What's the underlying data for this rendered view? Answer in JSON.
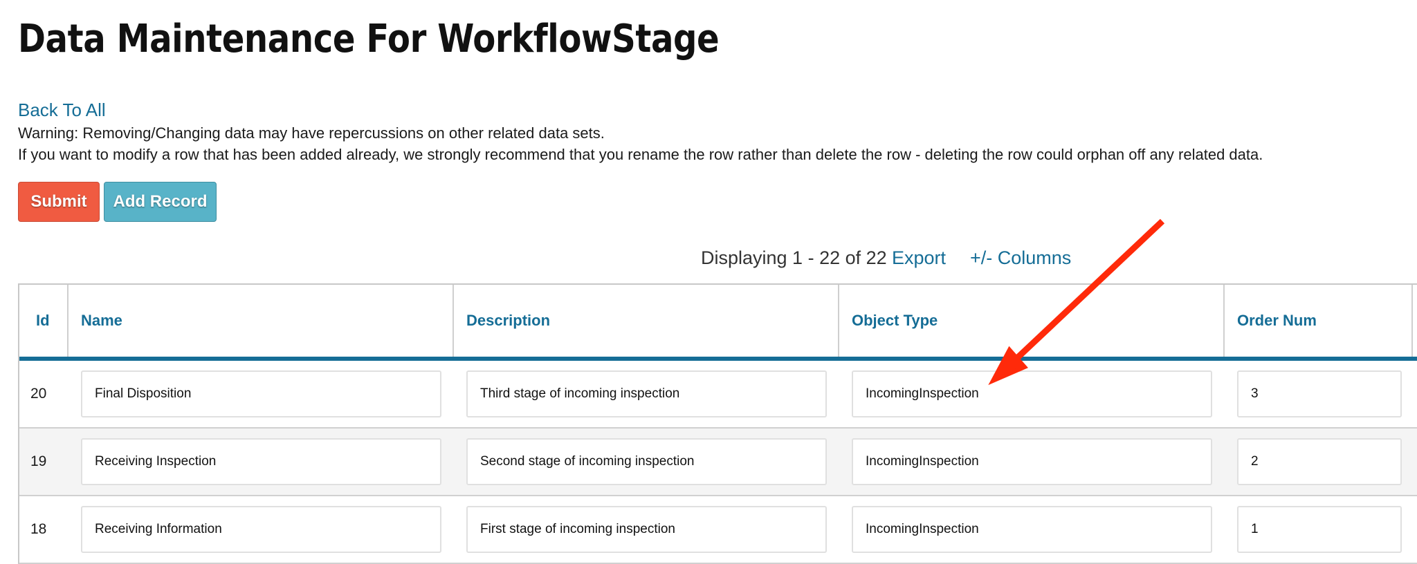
{
  "page": {
    "title": "Data Maintenance For WorkflowStage",
    "back_link": "Back To All",
    "warning_line1": "Warning: Removing/Changing data may have repercussions on other related data sets.",
    "warning_line2": "If you want to modify a row that has been added already, we strongly recommend that you rename the row rather than delete the row - deleting the row could orphan off any related data."
  },
  "toolbar": {
    "submit_label": "Submit",
    "add_record_label": "Add Record"
  },
  "pager": {
    "count_text": "Displaying 1 - 22 of 22",
    "export_label": "Export",
    "columns_label": "+/- Columns"
  },
  "table": {
    "headers": [
      "Id",
      "Name",
      "Description",
      "Object Type",
      "Order Num"
    ],
    "rows": [
      {
        "id": "20",
        "name": "Final Disposition",
        "description": "Third stage of incoming inspection",
        "object_type": "IncomingInspection",
        "order_num": "3"
      },
      {
        "id": "19",
        "name": "Receiving Inspection",
        "description": "Second stage of incoming inspection",
        "object_type": "IncomingInspection",
        "order_num": "2"
      },
      {
        "id": "18",
        "name": "Receiving Information",
        "description": "First stage of incoming inspection",
        "object_type": "IncomingInspection",
        "order_num": "1"
      }
    ]
  },
  "annotation": {
    "icon": "red-arrow-annotation",
    "color": "#ff2a0a"
  },
  "colors": {
    "accent": "#156d96",
    "submit": "#f05b41",
    "add_record": "#58b3c8"
  }
}
